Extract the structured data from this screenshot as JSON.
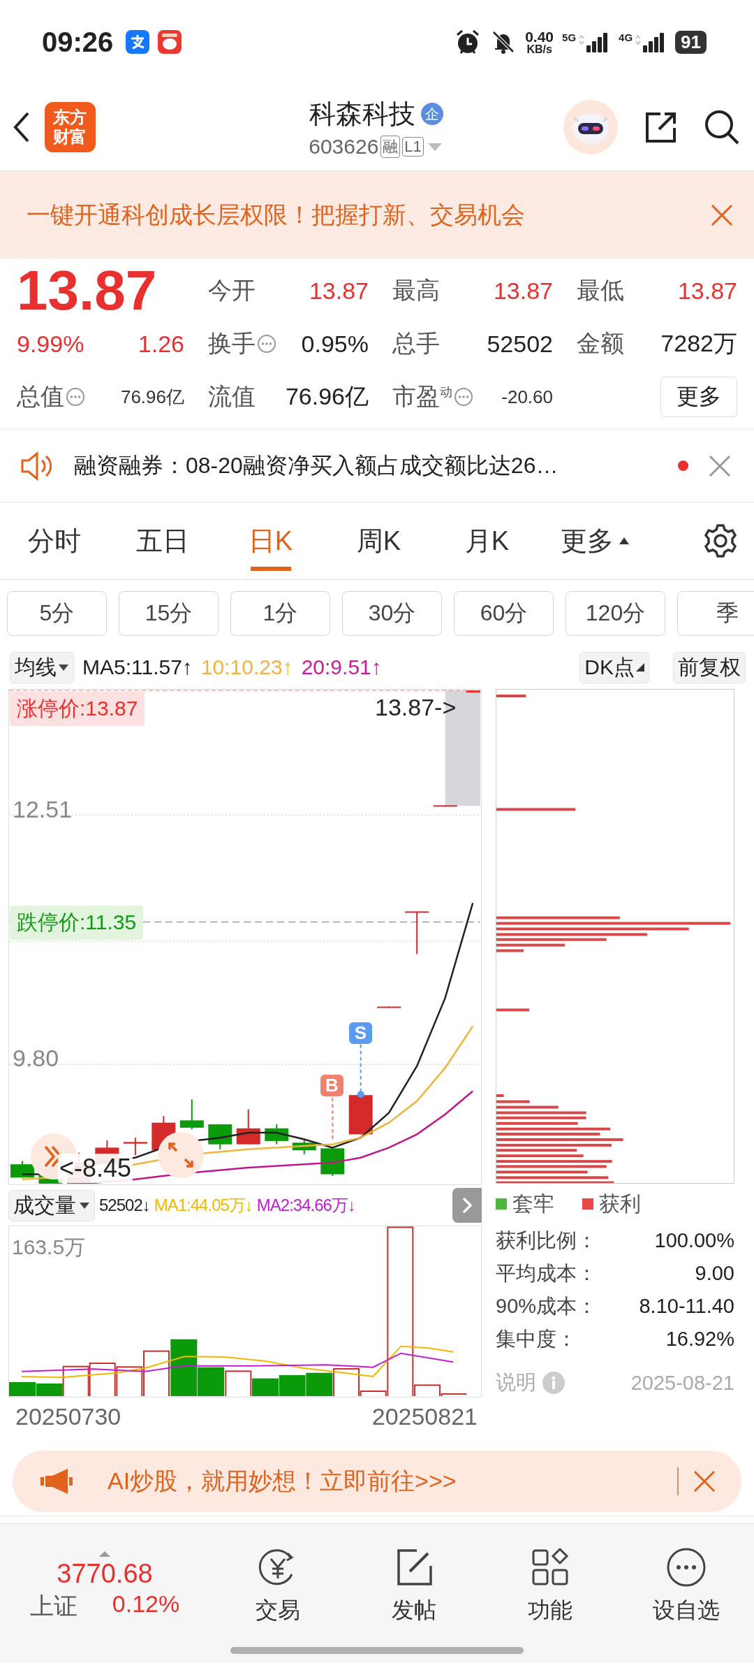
{
  "status_bar": {
    "time": "09:26",
    "net_speed": "0.40",
    "net_unit": "KB/s",
    "sim1": "5G",
    "sim2": "4G",
    "battery": "91"
  },
  "header": {
    "logo": "东方财富",
    "title": "科森科技",
    "title_badge": "企",
    "code": "603626",
    "tags": [
      "融",
      "L1"
    ]
  },
  "promo_banner": {
    "text": "一键开通科创成长层权限！把握打新、交易机会"
  },
  "quote": {
    "price": "13.87",
    "change_pct": "9.99%",
    "change": "1.26",
    "stats": [
      {
        "label": "今开",
        "value": "13.87",
        "kind": "up",
        "info": false
      },
      {
        "label": "最高",
        "value": "13.87",
        "kind": "up",
        "info": false
      },
      {
        "label": "最低",
        "value": "13.87",
        "kind": "up",
        "info": false
      },
      {
        "label": "换手",
        "value": "0.95%",
        "kind": "plain",
        "info": true
      },
      {
        "label": "总手",
        "value": "52502",
        "kind": "plain",
        "info": false
      },
      {
        "label": "金额",
        "value": "7282万",
        "kind": "plain",
        "info": false
      },
      {
        "label": "总值",
        "value": "76.96亿",
        "kind": "small",
        "info": true
      },
      {
        "label": "流值",
        "value": "76.96亿",
        "kind": "plain",
        "info": false
      },
      {
        "label": "市盈$^{动}$",
        "value": "-20.60",
        "kind": "small",
        "info": true
      }
    ],
    "more_button": "更多"
  },
  "notice": {
    "text": "融资融券：08-20融资净买入额占成交额比达26…",
    "unread": true
  },
  "tabs": [
    {
      "label": "分时",
      "selected": false,
      "kind": "plain"
    },
    {
      "label": "五日",
      "selected": false,
      "kind": "plain"
    },
    {
      "label": "日K",
      "selected": true,
      "kind": "plain"
    },
    {
      "label": "周K",
      "selected": false,
      "kind": "plain"
    },
    {
      "label": "月K",
      "selected": false,
      "kind": "plain"
    },
    {
      "label": "更多",
      "selected": false,
      "kind": "menu"
    }
  ],
  "periods": [
    "5分",
    "15分",
    "1分",
    "30分",
    "60分",
    "120分",
    "季"
  ],
  "ma_bar": {
    "selector": "均线",
    "ma": [
      {
        "text": "MA5:11.57↑",
        "color": "#222222"
      },
      {
        "text": "10:10.23↑",
        "color": "#f0b43c"
      },
      {
        "text": "20:9.51↑",
        "color": "#d0189a"
      }
    ],
    "dk": "DK点",
    "adjust": "前复权"
  },
  "kline": {
    "limit_up": "涨停价:13.87",
    "limit_down": "跌停价:11.35",
    "last": "13.87->",
    "yticks": [
      "12.51",
      "9.80"
    ],
    "low_marker": "<-8.45",
    "buy_mark": "B",
    "sell_mark": "S"
  },
  "volume": {
    "selector": "成交量",
    "value": "52502↓",
    "ma": [
      {
        "text": "MA1:44.05万↓",
        "color": "#f0b800"
      },
      {
        "text": "MA2:34.66万↓",
        "color": "#c020d0"
      }
    ],
    "max_label": "163.5万",
    "dates": [
      "20250730",
      "20250821"
    ]
  },
  "chips": {
    "legend": [
      {
        "label": "套牢",
        "color": "#4cb83c"
      },
      {
        "label": "获利",
        "color": "#e84848"
      }
    ],
    "rows": [
      {
        "label": "获利比例：",
        "value": "100.00%"
      },
      {
        "label": "平均成本：",
        "value": "9.00"
      },
      {
        "label": "90%成本：",
        "value": "8.10-11.40"
      },
      {
        "label": "集中度：",
        "value": "16.92%"
      }
    ],
    "note_label": "说明",
    "date": "2025-08-21"
  },
  "ad": {
    "text": "AI炒股，就用妙想！立即前往>>>"
  },
  "bottom_nav": {
    "index_value": "3770.68",
    "index_name": "上证",
    "index_change": "0.12%",
    "items": [
      {
        "label": "交易",
        "kind": "trade"
      },
      {
        "label": "发帖",
        "kind": "post"
      },
      {
        "label": "功能",
        "kind": "apps"
      },
      {
        "label": "设自选",
        "kind": "more"
      }
    ]
  }
}
